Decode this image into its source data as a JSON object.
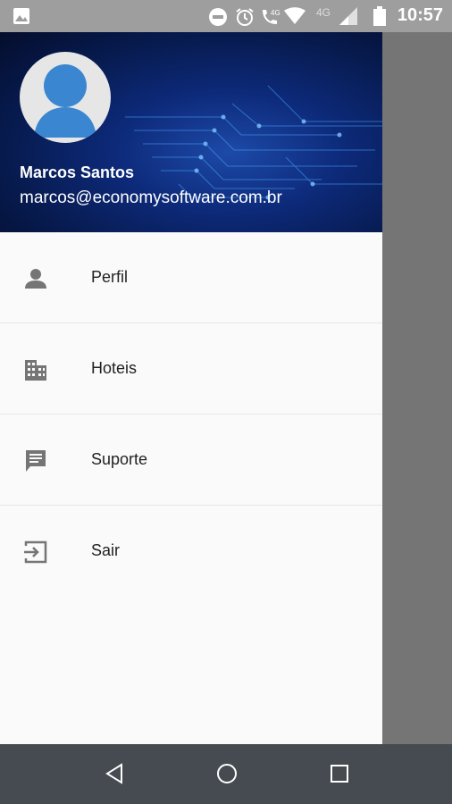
{
  "status_bar": {
    "time": "10:57",
    "signal_label": "4G",
    "icons": [
      "gallery-icon",
      "do-not-disturb-icon",
      "alarm-icon",
      "call-4g-icon",
      "wifi-icon",
      "signal-icon",
      "battery-icon"
    ]
  },
  "drawer": {
    "user_name": "Marcos Santos",
    "user_email": "marcos@economysoftware.com.br",
    "items": [
      {
        "label": "Perfil",
        "icon": "person-icon"
      },
      {
        "label": "Hoteis",
        "icon": "building-icon"
      },
      {
        "label": "Suporte",
        "icon": "chat-icon"
      },
      {
        "label": "Sair",
        "icon": "exit-icon"
      }
    ]
  },
  "nav_bar": {
    "buttons": [
      "back-icon",
      "home-icon",
      "recents-icon"
    ]
  },
  "colors": {
    "header_blue": "#0d2a7a",
    "avatar_blue": "#3a86d1",
    "icon_gray": "#757575",
    "nav_bg": "#454b50"
  }
}
